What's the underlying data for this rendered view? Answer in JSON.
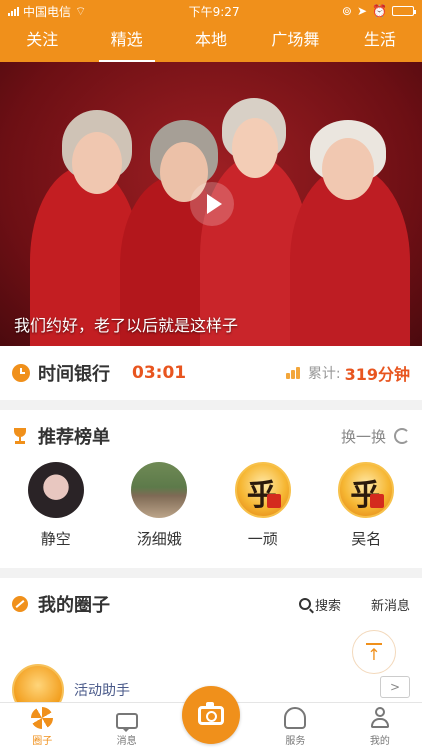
{
  "status_bar": {
    "carrier": "中国电信",
    "time": "下午9:27",
    "battery_level": 0.95
  },
  "top_tabs": {
    "active_index": 1,
    "items": [
      {
        "label": "关注"
      },
      {
        "label": "精选"
      },
      {
        "label": "本地"
      },
      {
        "label": "广场舞"
      },
      {
        "label": "生活"
      }
    ]
  },
  "hero": {
    "caption": "我们约好，老了以后就是这样子",
    "play_icon": "play-icon"
  },
  "time_bank": {
    "title": "时间银行",
    "time": "03:01",
    "total_label": "累计:",
    "total_value": "319分钟"
  },
  "recommend": {
    "title": "推荐榜单",
    "refresh_label": "换一换",
    "users": [
      {
        "name": "静空"
      },
      {
        "name": "汤细娥"
      },
      {
        "name": "一顽"
      },
      {
        "name": "吴名"
      }
    ]
  },
  "circles": {
    "title": "我的圈子",
    "search_label": "搜索",
    "new_message_label": "新消息",
    "assistant_name": "活动助手",
    "arrow_label": ">"
  },
  "bottom_nav": {
    "items": [
      {
        "label": "圈子",
        "icon": "circle-icon"
      },
      {
        "label": "消息",
        "icon": "message-icon"
      },
      {
        "label": "",
        "icon": "camera-icon"
      },
      {
        "label": "服务",
        "icon": "service-icon"
      },
      {
        "label": "我的",
        "icon": "profile-icon"
      }
    ]
  },
  "colors": {
    "accent": "#f0901b",
    "highlight": "#e8551f"
  }
}
